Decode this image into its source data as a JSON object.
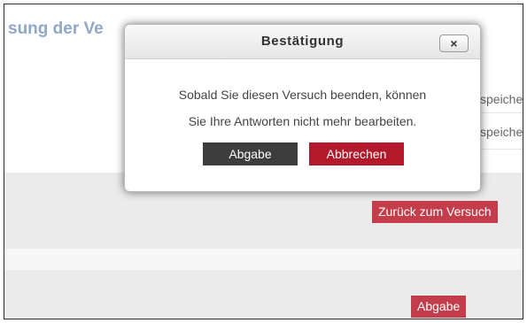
{
  "page": {
    "title": "sung der Ve",
    "side_labels": [
      "speiche",
      "speiche"
    ]
  },
  "buttons": {
    "back_to_attempt": "Zurück zum Versuch",
    "submit": "Abgabe"
  },
  "dialog": {
    "title": "Bestätigung",
    "close_label": "×",
    "message_line1": "Sobald Sie diesen Versuch beenden, können",
    "message_line2": "Sie Ihre Antworten nicht mehr bearbeiten.",
    "confirm_label": "Abgabe",
    "cancel_label": "Abbrechen"
  },
  "colors": {
    "accent_red": "#c43d4a",
    "title_blue": "#8fa8c8",
    "confirm_dark": "#3d3d3d"
  }
}
